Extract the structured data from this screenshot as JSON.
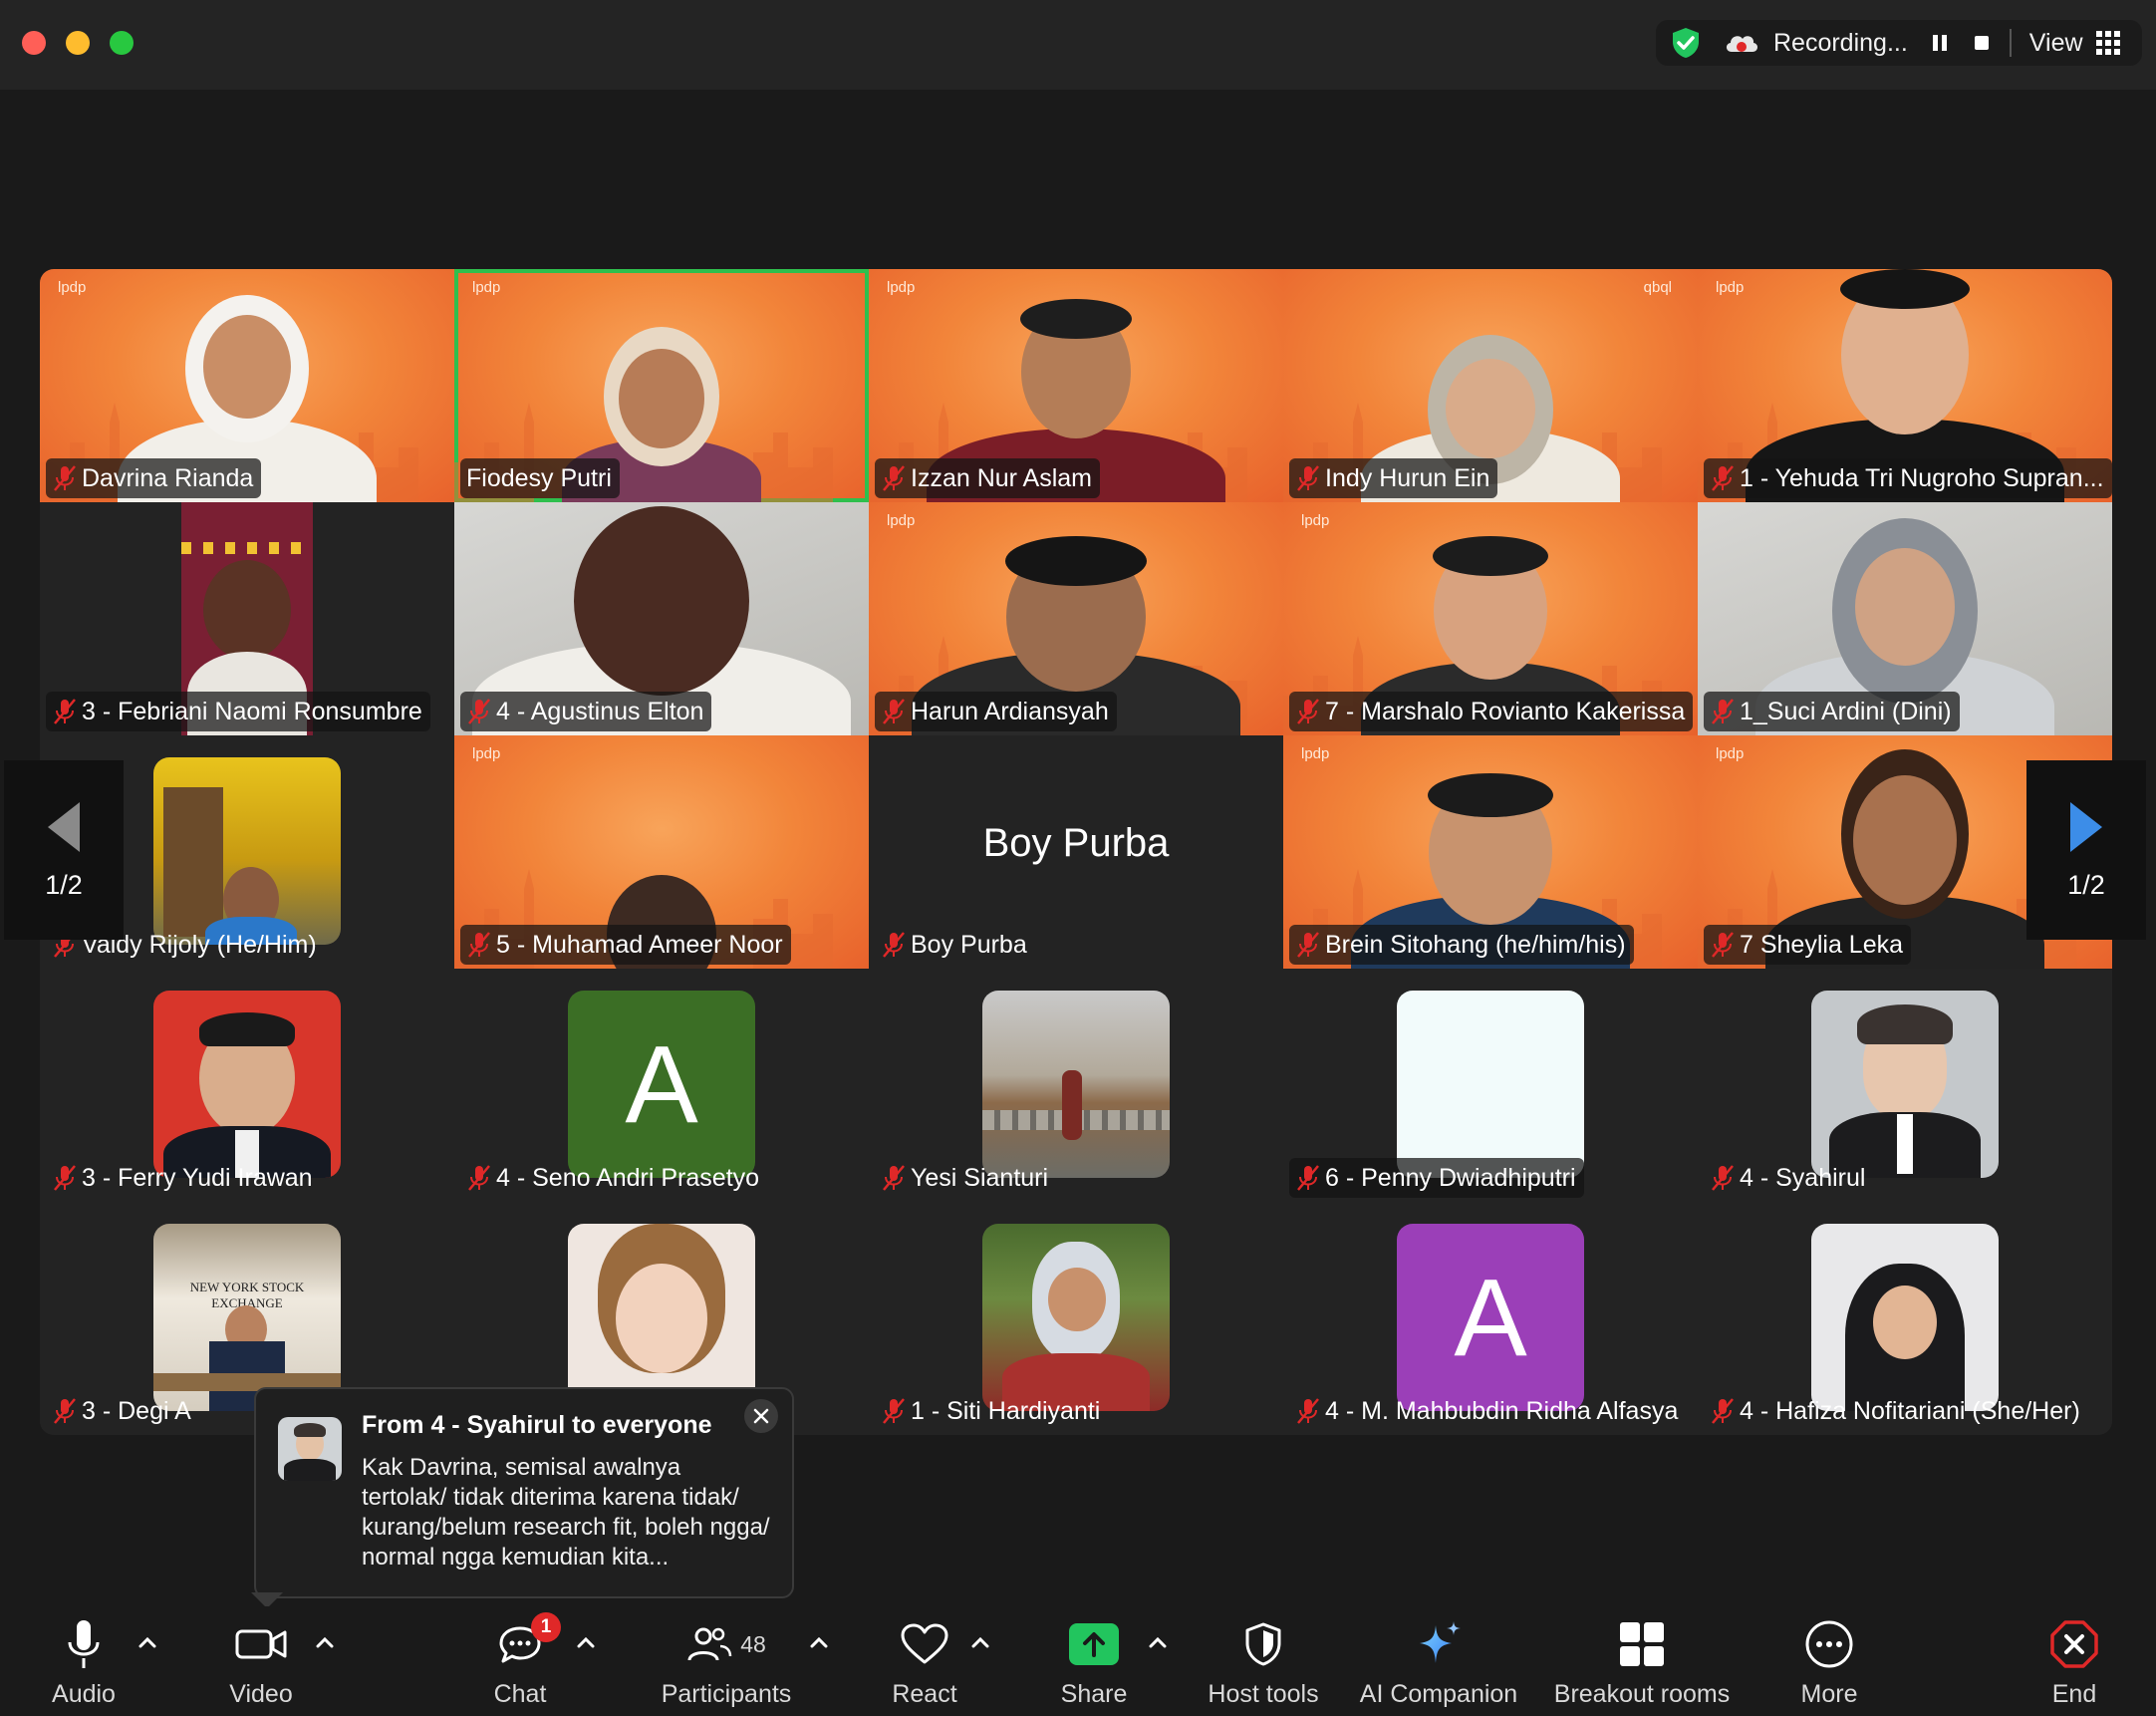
{
  "titlebar": {
    "recording_label": "Recording...",
    "view_label": "View"
  },
  "gallery": {
    "tiles": [
      {
        "name": "Davrina Rianda",
        "brand": "lpdp"
      },
      {
        "name": "Fiodesy Putri",
        "brand": "lpdp",
        "active": true
      },
      {
        "name": "Izzan Nur Aslam",
        "brand": "lpdp"
      },
      {
        "name": "Indy Hurun Ein",
        "brand": "lpdp"
      },
      {
        "name": "1 - Yehuda Tri Nugroho Supran...",
        "brand": "lpdp"
      },
      {
        "name": "3 - Febriani Naomi Ronsumbre"
      },
      {
        "name": "4 - Agustinus Elton"
      },
      {
        "name": "Harun Ardiansyah",
        "brand": "lpdp"
      },
      {
        "name": "7 - Marshalo Rovianto Kakerissa",
        "brand": "lpdp"
      },
      {
        "name": "1_Suci Ardini (Dini)"
      },
      {
        "name": "Valdy Rijoly (He/Him)"
      },
      {
        "name": "5 - Muhamad Ameer Noor",
        "brand": "lpdp"
      },
      {
        "name": "Boy Purba",
        "display_name": "Boy Purba"
      },
      {
        "name": "Brein Sitohang (he/him/his)",
        "brand": "lpdp"
      },
      {
        "name": "7 Sheylia Leka",
        "brand": "lpdp"
      },
      {
        "name": "3 - Ferry Yudi Irawan"
      },
      {
        "name": "4 - Seno Andri Prasetyo",
        "avatar_letter": "A"
      },
      {
        "name": "Yesi Sianturi"
      },
      {
        "name": "6 - Penny Dwiadhiputri"
      },
      {
        "name": "4 - Syahirul"
      },
      {
        "name": "3 - Degi A",
        "photo_caption": "NEW YORK STOCK EXCHANGE"
      },
      {
        "name": "ri"
      },
      {
        "name": "1 - Siti Hardiyanti"
      },
      {
        "name": "4 - M. Mahbubdin Ridha Alfasya",
        "avatar_letter": "A"
      },
      {
        "name": "4 - Hafiza Nofitariani (She/Her)"
      }
    ],
    "brand_alt": "qbql"
  },
  "paging": {
    "left_page": "1/2",
    "right_page": "1/2"
  },
  "chat_toast": {
    "from": "From 4 - Syahirul to everyone",
    "message": "Kak Davrina, semisal awalnya tertolak/ tidak diterima karena tidak/ kurang/belum research fit, boleh ngga/ normal ngga kemudian kita..."
  },
  "toolbar": {
    "audio": "Audio",
    "video": "Video",
    "chat": "Chat",
    "chat_badge": "1",
    "participants": "Participants",
    "participants_count": "48",
    "react": "React",
    "share": "Share",
    "host_tools": "Host tools",
    "ai_companion": "AI Companion",
    "breakout_rooms": "Breakout rooms",
    "more": "More",
    "end": "End"
  },
  "colors": {
    "accent_green": "#2fbf4d",
    "share_green": "#22c55e",
    "end_red": "#e02828",
    "lpdp_orange": "#f2853a"
  }
}
